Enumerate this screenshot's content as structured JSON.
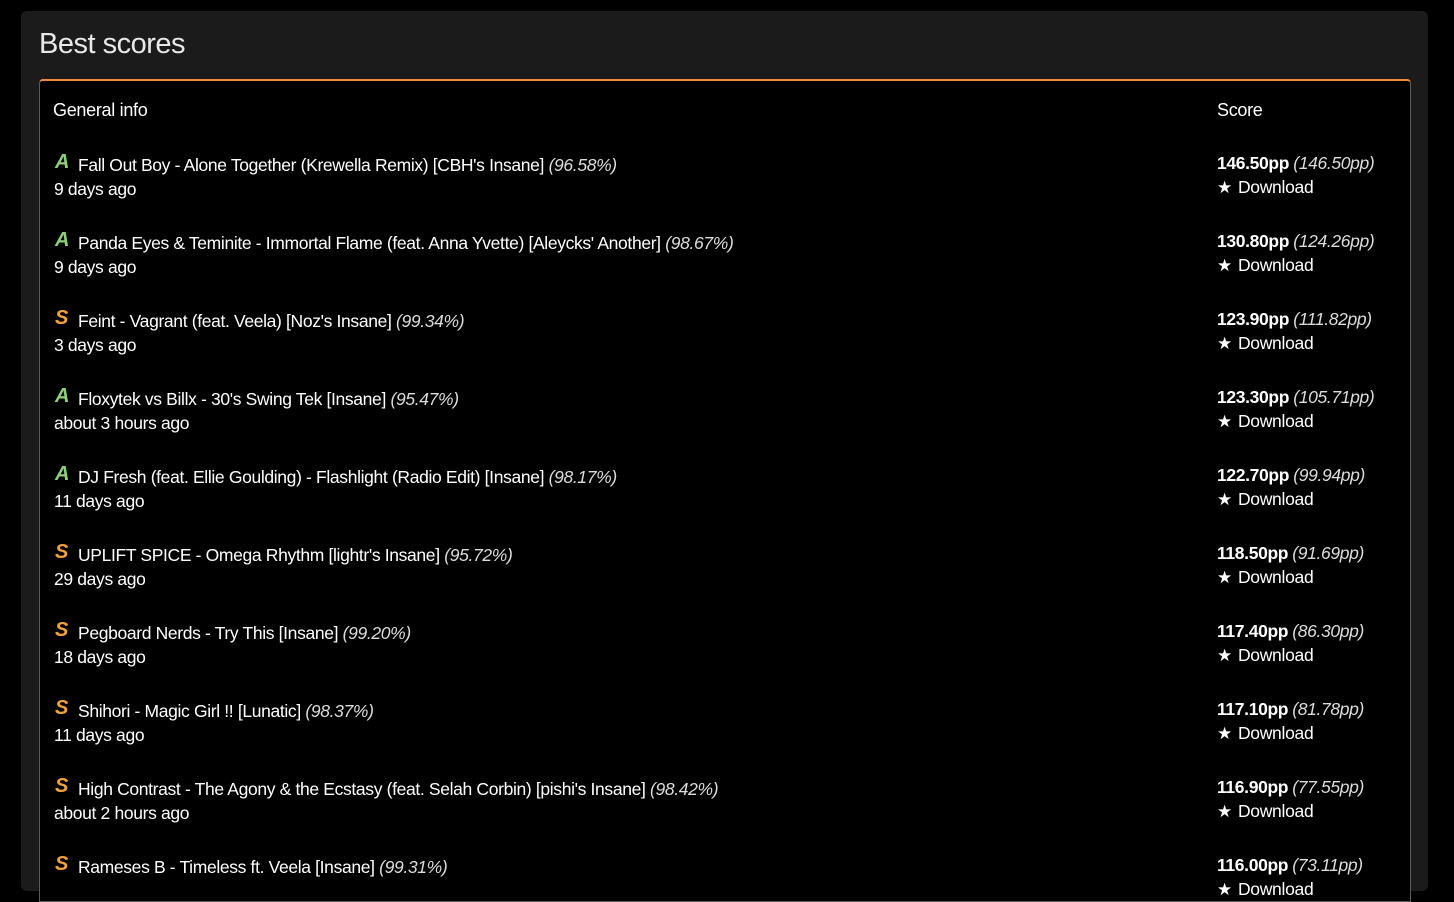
{
  "panel": {
    "title": "Best scores"
  },
  "table": {
    "headers": {
      "info": "General info",
      "score": "Score"
    },
    "download_label": "Download",
    "star_icon": "★",
    "rows": [
      {
        "grade": "A",
        "grade_class": "a",
        "title": "Fall Out Boy - Alone Together (Krewella Remix) [CBH's Insane]",
        "accuracy": "(96.58%)",
        "date": "9 days ago",
        "pp": "146.50pp",
        "weighted": "(146.50pp)"
      },
      {
        "grade": "A",
        "grade_class": "a",
        "title": "Panda Eyes & Teminite - Immortal Flame (feat. Anna Yvette) [Aleycks' Another]",
        "accuracy": "(98.67%)",
        "date": "9 days ago",
        "pp": "130.80pp",
        "weighted": "(124.26pp)"
      },
      {
        "grade": "S",
        "grade_class": "s",
        "title": "Feint - Vagrant (feat. Veela) [Noz's Insane]",
        "accuracy": "(99.34%)",
        "date": "3 days ago",
        "pp": "123.90pp",
        "weighted": "(111.82pp)"
      },
      {
        "grade": "A",
        "grade_class": "a",
        "title": "Floxytek vs Billx - 30's Swing Tek [Insane]",
        "accuracy": "(95.47%)",
        "date": "about 3 hours ago",
        "pp": "123.30pp",
        "weighted": "(105.71pp)"
      },
      {
        "grade": "A",
        "grade_class": "a",
        "title": "DJ Fresh (feat. Ellie Goulding) - Flashlight (Radio Edit) [Insane]",
        "accuracy": "(98.17%)",
        "date": "11 days ago",
        "pp": "122.70pp",
        "weighted": "(99.94pp)"
      },
      {
        "grade": "S",
        "grade_class": "s",
        "title": "UPLIFT SPICE - Omega Rhythm [lightr's Insane]",
        "accuracy": "(95.72%)",
        "date": "29 days ago",
        "pp": "118.50pp",
        "weighted": "(91.69pp)"
      },
      {
        "grade": "S",
        "grade_class": "s",
        "title": "Pegboard Nerds - Try This [Insane]",
        "accuracy": "(99.20%)",
        "date": "18 days ago",
        "pp": "117.40pp",
        "weighted": "(86.30pp)"
      },
      {
        "grade": "S",
        "grade_class": "s",
        "title": "Shihori - Magic Girl !! [Lunatic]",
        "accuracy": "(98.37%)",
        "date": "11 days ago",
        "pp": "117.10pp",
        "weighted": "(81.78pp)"
      },
      {
        "grade": "S",
        "grade_class": "s",
        "title": "High Contrast - The Agony & the Ecstasy (feat. Selah Corbin) [pishi's Insane]",
        "accuracy": "(98.42%)",
        "date": "about 2 hours ago",
        "pp": "116.90pp",
        "weighted": "(77.55pp)"
      },
      {
        "grade": "S",
        "grade_class": "s",
        "title": "Rameses B - Timeless ft. Veela [Insane]",
        "accuracy": "(99.31%)",
        "date": "",
        "pp": "116.00pp",
        "weighted": "(73.11pp)"
      }
    ]
  }
}
